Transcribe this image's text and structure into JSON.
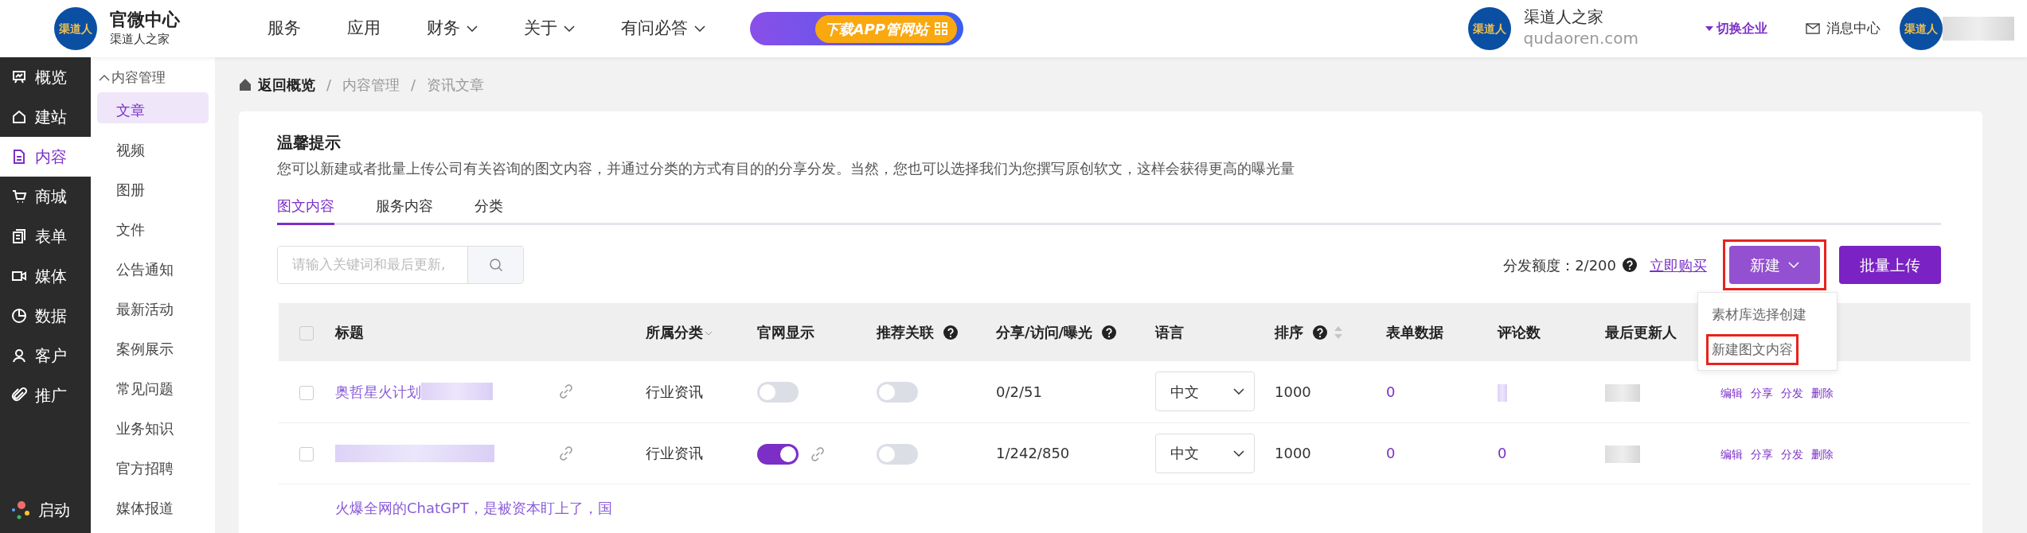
{
  "header": {
    "logo_text": "渠道人",
    "app_title": "官微中心",
    "app_subtitle": "渠道人之家",
    "nav": [
      {
        "label": "服务",
        "has_dropdown": false
      },
      {
        "label": "应用",
        "has_dropdown": false
      },
      {
        "label": "财务",
        "has_dropdown": true
      },
      {
        "label": "关于",
        "has_dropdown": true
      },
      {
        "label": "有问必答",
        "has_dropdown": true
      }
    ],
    "banner": {
      "label": "下载APP管网站"
    },
    "company": {
      "logo_text": "渠道人",
      "name": "渠道人之家",
      "domain": "qudaoren.com"
    },
    "switch_label": "切换企业",
    "messages_label": "消息中心",
    "avatar": {
      "logo_text": "渠道人",
      "name_redacted": true
    }
  },
  "sidebar": {
    "items": [
      {
        "label": "概览",
        "selected": false
      },
      {
        "label": "建站",
        "selected": false
      },
      {
        "label": "内容",
        "selected": true
      },
      {
        "label": "商城",
        "selected": false
      },
      {
        "label": "表单",
        "selected": false
      },
      {
        "label": "媒体",
        "selected": false
      },
      {
        "label": "数据",
        "selected": false
      },
      {
        "label": "客户",
        "selected": false
      },
      {
        "label": "推广",
        "selected": false
      }
    ],
    "footer": {
      "label": "启动"
    }
  },
  "submenu": {
    "group": "内容管理",
    "expanded": true,
    "items": [
      {
        "label": "文章",
        "selected": true
      },
      {
        "label": "视频",
        "selected": false
      },
      {
        "label": "图册",
        "selected": false
      },
      {
        "label": "文件",
        "selected": false
      },
      {
        "label": "公告通知",
        "selected": false
      },
      {
        "label": "最新活动",
        "selected": false
      },
      {
        "label": "案例展示",
        "selected": false
      },
      {
        "label": "常见问题",
        "selected": false
      },
      {
        "label": "业务知识",
        "selected": false
      },
      {
        "label": "官方招聘",
        "selected": false
      },
      {
        "label": "媒体报道",
        "selected": false
      }
    ]
  },
  "breadcrumb": [
    {
      "label": "返回概览"
    },
    {
      "separator": "/",
      "label": "内容管理"
    },
    {
      "separator": "/",
      "label": "资讯文章"
    }
  ],
  "notice": {
    "title": "温馨提示",
    "text": "您可以新建或者批量上传公司有关咨询的图文内容，并通过分类的方式有目的的分享分发。当然，您也可以选择我们为您撰写原创软文，这样会获得更高的曝光量"
  },
  "tabs": [
    {
      "label": "图文内容",
      "selected": true
    },
    {
      "label": "服务内容",
      "selected": false
    },
    {
      "label": "分类",
      "selected": false
    }
  ],
  "search": {
    "placeholder": "请输入关键词和最后更新,"
  },
  "quota": {
    "label": "分发额度：2/200",
    "link": "立即购买"
  },
  "buttons": [
    {
      "label": "新建",
      "kind": "dropdown",
      "highlighted": true
    },
    {
      "label": "批量上传",
      "kind": "plain",
      "highlighted": false
    }
  ],
  "new_menu": {
    "items": [
      {
        "label": "素材库选择创建",
        "highlighted": false
      },
      {
        "label": "新建图文内容",
        "highlighted": true
      }
    ]
  },
  "table": {
    "select_all": {
      "checked": false
    },
    "columns": [
      {
        "label": "标题"
      },
      {
        "label": "所属分类",
        "filter": true
      },
      {
        "label": "官网显示"
      },
      {
        "label": "推荐关联",
        "help": true
      },
      {
        "label": "分享/访问/曝光",
        "help": true
      },
      {
        "label": "语言"
      },
      {
        "label": "排序",
        "help": true,
        "sortable": true
      },
      {
        "label": "表单数据"
      },
      {
        "label": "评论数"
      },
      {
        "label": "最后更新人"
      }
    ],
    "rows": [
      {
        "selected": false,
        "title": "奥哲星火计划",
        "title_redacted": true,
        "category": "行业资讯",
        "site_display": false,
        "site_link": false,
        "recommend": false,
        "stats": "0/2/51",
        "language": "中文",
        "order": "1000",
        "form_data": "0",
        "comments_redacted": true,
        "updater_redacted": true,
        "actions": [
          "编辑",
          "分享",
          "分发",
          "删除"
        ]
      },
      {
        "selected": false,
        "title_redacted": true,
        "category": "行业资讯",
        "site_display": true,
        "site_link": true,
        "recommend": false,
        "stats": "1/242/850",
        "language": "中文",
        "order": "1000",
        "form_data": "0",
        "comments": "0",
        "updater_redacted": true,
        "actions": [
          "编辑",
          "分享",
          "分发",
          "删除"
        ]
      },
      {
        "title": "火爆全网的ChatGPT，是被资本盯上了，国"
      }
    ]
  }
}
